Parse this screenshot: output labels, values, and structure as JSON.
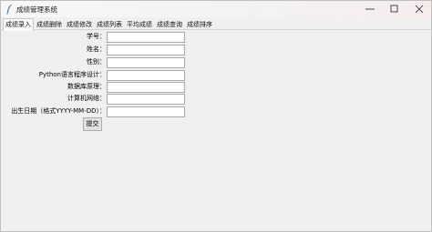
{
  "window": {
    "title": "成绩管理系统",
    "icons": {
      "app": "feather-icon",
      "minimize": "minimize-icon",
      "maximize": "maximize-icon",
      "close": "close-icon"
    }
  },
  "tabs": [
    {
      "label": "成绩录入",
      "active": true
    },
    {
      "label": "成绩删除",
      "active": false
    },
    {
      "label": "成绩修改",
      "active": false
    },
    {
      "label": "成绩列表",
      "active": false
    },
    {
      "label": "平均成绩",
      "active": false
    },
    {
      "label": "成绩查询",
      "active": false
    },
    {
      "label": "成绩排序",
      "active": false
    }
  ],
  "form": {
    "student_id_label": "学号：",
    "name_label": "姓名：",
    "gender_label": "性别：",
    "python_label": "Python语言程序设计：",
    "database_label": "数据库原理：",
    "network_label": "计算机网络：",
    "date_label": "出生日期（格式YYYY-MM-DD）：",
    "student_id_value": "",
    "name_value": "",
    "gender_value": "",
    "python_value": "",
    "database_value": "",
    "network_value": "",
    "date_value": "",
    "submit_label": "提交"
  }
}
